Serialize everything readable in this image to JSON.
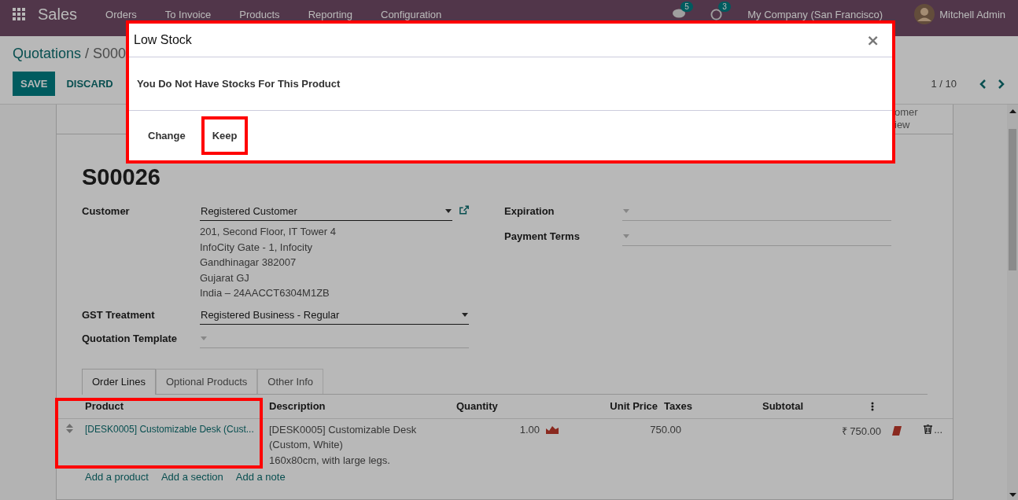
{
  "navbar": {
    "app_name": "Sales",
    "menu": [
      "Orders",
      "To Invoice",
      "Products",
      "Reporting",
      "Configuration"
    ],
    "messages_badge": "5",
    "activities_badge": "3",
    "company": "My Company (San Francisco)",
    "user": "Mitchell Admin"
  },
  "breadcrumb": {
    "parent": "Quotations",
    "separator": "/",
    "current": "S000"
  },
  "actions": [
    {
      "label": "SAVE",
      "kind": "primary"
    },
    {
      "label": "DISCARD",
      "kind": "link"
    }
  ],
  "pager": "1 / 10",
  "stat_button_fragment": [
    "omer",
    "iew"
  ],
  "record": {
    "name": "S00026",
    "left_fields": [
      {
        "label": "Customer",
        "value": "Registered Customer",
        "external_link": true,
        "address": [
          "201, Second Floor, IT Tower 4",
          "InfoCity Gate - 1, Infocity",
          "Gandhinagar 382007",
          "Gujarat GJ",
          "India – 24AACCT6304M1ZB"
        ]
      },
      {
        "label": "GST Treatment",
        "value": "Registered Business - Regular",
        "external_link": false
      },
      {
        "label": "Quotation Template",
        "external_link": false
      }
    ],
    "right_fields": [
      {
        "label": "Expiration"
      },
      {
        "label": "Payment Terms"
      }
    ]
  },
  "tabs": [
    {
      "label": "Order Lines",
      "selected": true
    },
    {
      "label": "Optional Products",
      "selected": false
    },
    {
      "label": "Other Info",
      "selected": false
    }
  ],
  "table": {
    "columns": [
      "Product",
      "Description",
      "Quantity",
      "Unit Price",
      "Taxes",
      "Subtotal"
    ],
    "product_column_highlighted": true,
    "rows": [
      {
        "product": "[DESK0005] Customizable Desk (Cust...",
        "description": [
          "[DESK0005] Customizable Desk",
          "(Custom, White)",
          "160x80cm, with large legs."
        ],
        "quantity": "1.00",
        "unit_price": "750.00",
        "subtotal": "₹ 750.00",
        "delete_suffix": "..."
      }
    ],
    "add_links": [
      "Add a product",
      "Add a section",
      "Add a note"
    ]
  },
  "dialog": {
    "title": "Low Stock",
    "close": "×",
    "message": "You Do Not Have Stocks For This Product",
    "highlighted": true,
    "buttons": [
      {
        "label": "Change",
        "highlighted": false
      },
      {
        "label": "Keep",
        "highlighted": true
      }
    ]
  }
}
